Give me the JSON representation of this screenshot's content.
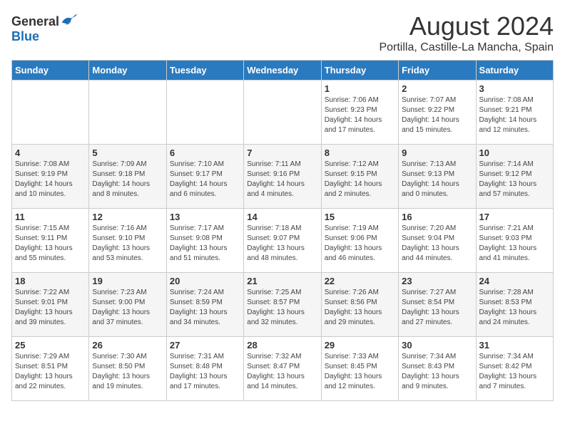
{
  "header": {
    "logo_general": "General",
    "logo_blue": "Blue",
    "month_title": "August 2024",
    "location": "Portilla, Castille-La Mancha, Spain"
  },
  "days_of_week": [
    "Sunday",
    "Monday",
    "Tuesday",
    "Wednesday",
    "Thursday",
    "Friday",
    "Saturday"
  ],
  "weeks": [
    [
      {
        "day": "",
        "info": ""
      },
      {
        "day": "",
        "info": ""
      },
      {
        "day": "",
        "info": ""
      },
      {
        "day": "",
        "info": ""
      },
      {
        "day": "1",
        "info": "Sunrise: 7:06 AM\nSunset: 9:23 PM\nDaylight: 14 hours\nand 17 minutes."
      },
      {
        "day": "2",
        "info": "Sunrise: 7:07 AM\nSunset: 9:22 PM\nDaylight: 14 hours\nand 15 minutes."
      },
      {
        "day": "3",
        "info": "Sunrise: 7:08 AM\nSunset: 9:21 PM\nDaylight: 14 hours\nand 12 minutes."
      }
    ],
    [
      {
        "day": "4",
        "info": "Sunrise: 7:08 AM\nSunset: 9:19 PM\nDaylight: 14 hours\nand 10 minutes."
      },
      {
        "day": "5",
        "info": "Sunrise: 7:09 AM\nSunset: 9:18 PM\nDaylight: 14 hours\nand 8 minutes."
      },
      {
        "day": "6",
        "info": "Sunrise: 7:10 AM\nSunset: 9:17 PM\nDaylight: 14 hours\nand 6 minutes."
      },
      {
        "day": "7",
        "info": "Sunrise: 7:11 AM\nSunset: 9:16 PM\nDaylight: 14 hours\nand 4 minutes."
      },
      {
        "day": "8",
        "info": "Sunrise: 7:12 AM\nSunset: 9:15 PM\nDaylight: 14 hours\nand 2 minutes."
      },
      {
        "day": "9",
        "info": "Sunrise: 7:13 AM\nSunset: 9:13 PM\nDaylight: 14 hours\nand 0 minutes."
      },
      {
        "day": "10",
        "info": "Sunrise: 7:14 AM\nSunset: 9:12 PM\nDaylight: 13 hours\nand 57 minutes."
      }
    ],
    [
      {
        "day": "11",
        "info": "Sunrise: 7:15 AM\nSunset: 9:11 PM\nDaylight: 13 hours\nand 55 minutes."
      },
      {
        "day": "12",
        "info": "Sunrise: 7:16 AM\nSunset: 9:10 PM\nDaylight: 13 hours\nand 53 minutes."
      },
      {
        "day": "13",
        "info": "Sunrise: 7:17 AM\nSunset: 9:08 PM\nDaylight: 13 hours\nand 51 minutes."
      },
      {
        "day": "14",
        "info": "Sunrise: 7:18 AM\nSunset: 9:07 PM\nDaylight: 13 hours\nand 48 minutes."
      },
      {
        "day": "15",
        "info": "Sunrise: 7:19 AM\nSunset: 9:06 PM\nDaylight: 13 hours\nand 46 minutes."
      },
      {
        "day": "16",
        "info": "Sunrise: 7:20 AM\nSunset: 9:04 PM\nDaylight: 13 hours\nand 44 minutes."
      },
      {
        "day": "17",
        "info": "Sunrise: 7:21 AM\nSunset: 9:03 PM\nDaylight: 13 hours\nand 41 minutes."
      }
    ],
    [
      {
        "day": "18",
        "info": "Sunrise: 7:22 AM\nSunset: 9:01 PM\nDaylight: 13 hours\nand 39 minutes."
      },
      {
        "day": "19",
        "info": "Sunrise: 7:23 AM\nSunset: 9:00 PM\nDaylight: 13 hours\nand 37 minutes."
      },
      {
        "day": "20",
        "info": "Sunrise: 7:24 AM\nSunset: 8:59 PM\nDaylight: 13 hours\nand 34 minutes."
      },
      {
        "day": "21",
        "info": "Sunrise: 7:25 AM\nSunset: 8:57 PM\nDaylight: 13 hours\nand 32 minutes."
      },
      {
        "day": "22",
        "info": "Sunrise: 7:26 AM\nSunset: 8:56 PM\nDaylight: 13 hours\nand 29 minutes."
      },
      {
        "day": "23",
        "info": "Sunrise: 7:27 AM\nSunset: 8:54 PM\nDaylight: 13 hours\nand 27 minutes."
      },
      {
        "day": "24",
        "info": "Sunrise: 7:28 AM\nSunset: 8:53 PM\nDaylight: 13 hours\nand 24 minutes."
      }
    ],
    [
      {
        "day": "25",
        "info": "Sunrise: 7:29 AM\nSunset: 8:51 PM\nDaylight: 13 hours\nand 22 minutes."
      },
      {
        "day": "26",
        "info": "Sunrise: 7:30 AM\nSunset: 8:50 PM\nDaylight: 13 hours\nand 19 minutes."
      },
      {
        "day": "27",
        "info": "Sunrise: 7:31 AM\nSunset: 8:48 PM\nDaylight: 13 hours\nand 17 minutes."
      },
      {
        "day": "28",
        "info": "Sunrise: 7:32 AM\nSunset: 8:47 PM\nDaylight: 13 hours\nand 14 minutes."
      },
      {
        "day": "29",
        "info": "Sunrise: 7:33 AM\nSunset: 8:45 PM\nDaylight: 13 hours\nand 12 minutes."
      },
      {
        "day": "30",
        "info": "Sunrise: 7:34 AM\nSunset: 8:43 PM\nDaylight: 13 hours\nand 9 minutes."
      },
      {
        "day": "31",
        "info": "Sunrise: 7:34 AM\nSunset: 8:42 PM\nDaylight: 13 hours\nand 7 minutes."
      }
    ]
  ]
}
